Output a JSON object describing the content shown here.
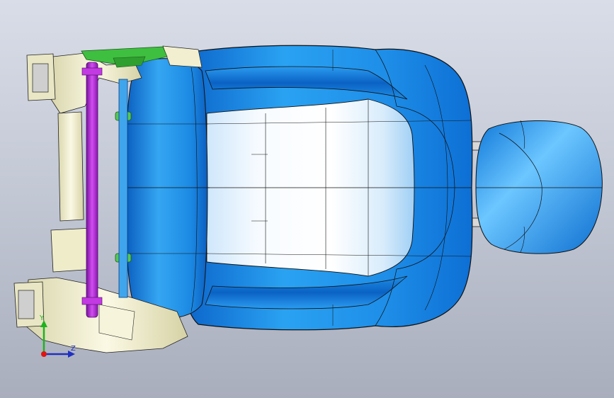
{
  "viewport": {
    "background_top": "#d9dde8",
    "background_bottom": "#a9aebd"
  },
  "model": {
    "shell_color": "#1f8fe6",
    "shell_highlight": "#bfe6ff",
    "cushion_light": "#f4f8fc",
    "frame_color": "#f1efcf",
    "rod_color": "#b22ad6",
    "bracket_color": "#3fbf3f",
    "edge_color": "#1a1a1a"
  },
  "triad": {
    "y_label": "Y",
    "z_label": "Z",
    "y_color": "#1db31d",
    "z_color": "#2030c0",
    "origin_color": "#e01414"
  }
}
